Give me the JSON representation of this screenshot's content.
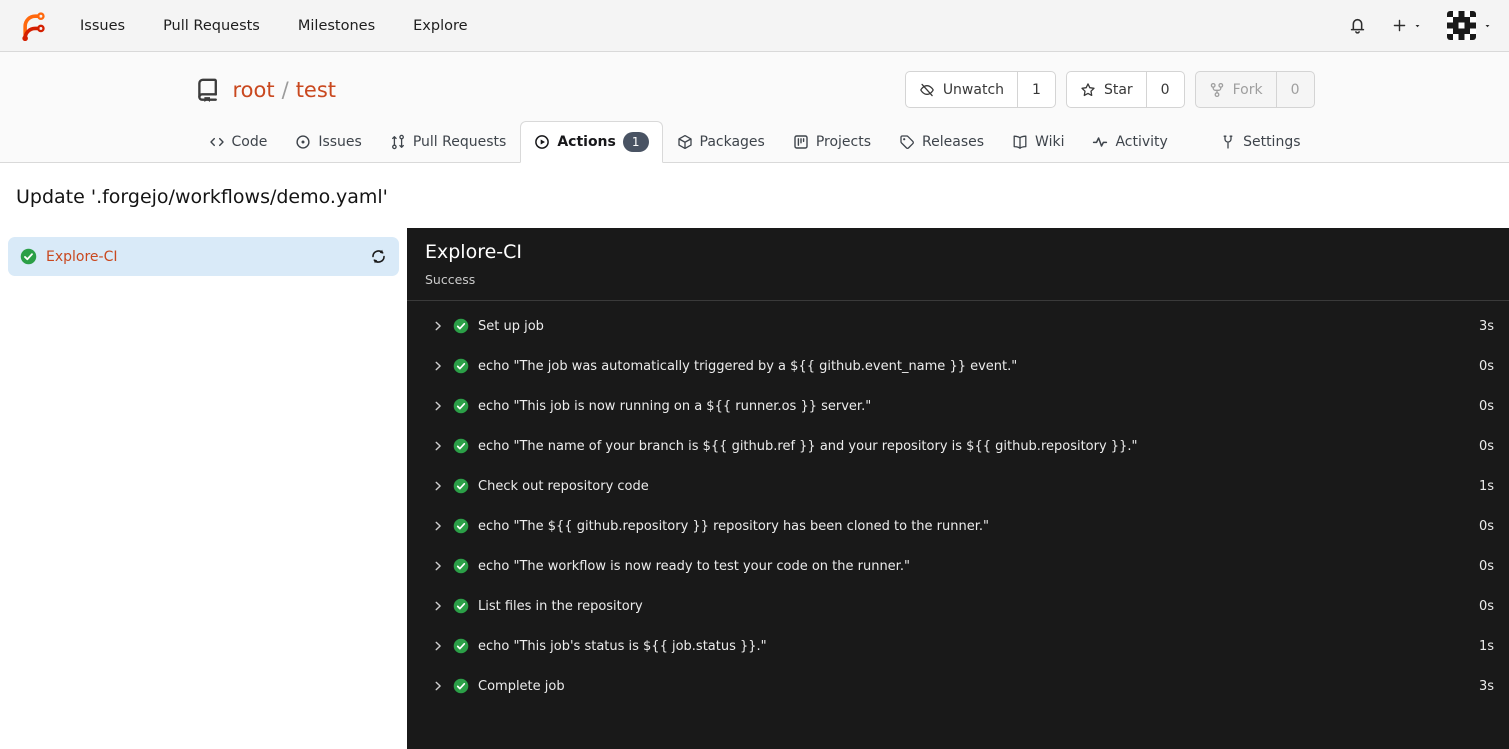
{
  "navbar": {
    "items": [
      {
        "label": "Issues"
      },
      {
        "label": "Pull Requests"
      },
      {
        "label": "Milestones"
      },
      {
        "label": "Explore"
      }
    ]
  },
  "repo_header": {
    "owner": "root",
    "separator": "/",
    "name": "test",
    "actions": [
      {
        "label": "Unwatch",
        "count": "1",
        "icon": "eye-closed-icon",
        "disabled": false
      },
      {
        "label": "Star",
        "count": "0",
        "icon": "star-icon",
        "disabled": false
      },
      {
        "label": "Fork",
        "count": "0",
        "icon": "fork-icon",
        "disabled": true
      }
    ]
  },
  "repo_tabs": {
    "items": [
      {
        "label": "Code",
        "icon": "code-icon"
      },
      {
        "label": "Issues",
        "icon": "issue-circle-icon"
      },
      {
        "label": "Pull Requests",
        "icon": "pull-request-icon"
      },
      {
        "label": "Actions",
        "icon": "play-circle-icon",
        "active": true,
        "badge": "1"
      },
      {
        "label": "Packages",
        "icon": "package-icon"
      },
      {
        "label": "Projects",
        "icon": "project-board-icon"
      },
      {
        "label": "Releases",
        "icon": "tag-icon"
      },
      {
        "label": "Wiki",
        "icon": "wiki-book-icon"
      },
      {
        "label": "Activity",
        "icon": "pulse-icon"
      },
      {
        "label": "Settings",
        "icon": "tools-icon",
        "right": true
      }
    ]
  },
  "page": {
    "title": "Update '.forgejo/workflows/demo.yaml'"
  },
  "job_sidebar": {
    "jobs": [
      {
        "label": "Explore-CI",
        "status": "success"
      }
    ]
  },
  "job_panel": {
    "title": "Explore-CI",
    "status": "Success",
    "steps": [
      {
        "label": "Set up job",
        "duration": "3s"
      },
      {
        "label": "echo \"The job was automatically triggered by a ${{ github.event_name }} event.\"",
        "duration": "0s"
      },
      {
        "label": "echo \"This job is now running on a ${{ runner.os }} server.\"",
        "duration": "0s"
      },
      {
        "label": "echo \"The name of your branch is ${{ github.ref }} and your repository is ${{ github.repository }}.\"",
        "duration": "0s"
      },
      {
        "label": "Check out repository code",
        "duration": "1s"
      },
      {
        "label": "echo \"The ${{ github.repository }} repository has been cloned to the runner.\"",
        "duration": "0s"
      },
      {
        "label": "echo \"The workflow is now ready to test your code on the runner.\"",
        "duration": "0s"
      },
      {
        "label": "List files in the repository",
        "duration": "0s"
      },
      {
        "label": "echo \"This job's status is ${{ job.status }}.\"",
        "duration": "1s"
      },
      {
        "label": "Complete job",
        "duration": "3s"
      }
    ]
  },
  "colors": {
    "accent": "#c9481f",
    "success_green": "#2b9f47",
    "panel_bg": "#191919",
    "selected_job_bg": "#d9eaf8",
    "badge_bg": "#495363"
  }
}
